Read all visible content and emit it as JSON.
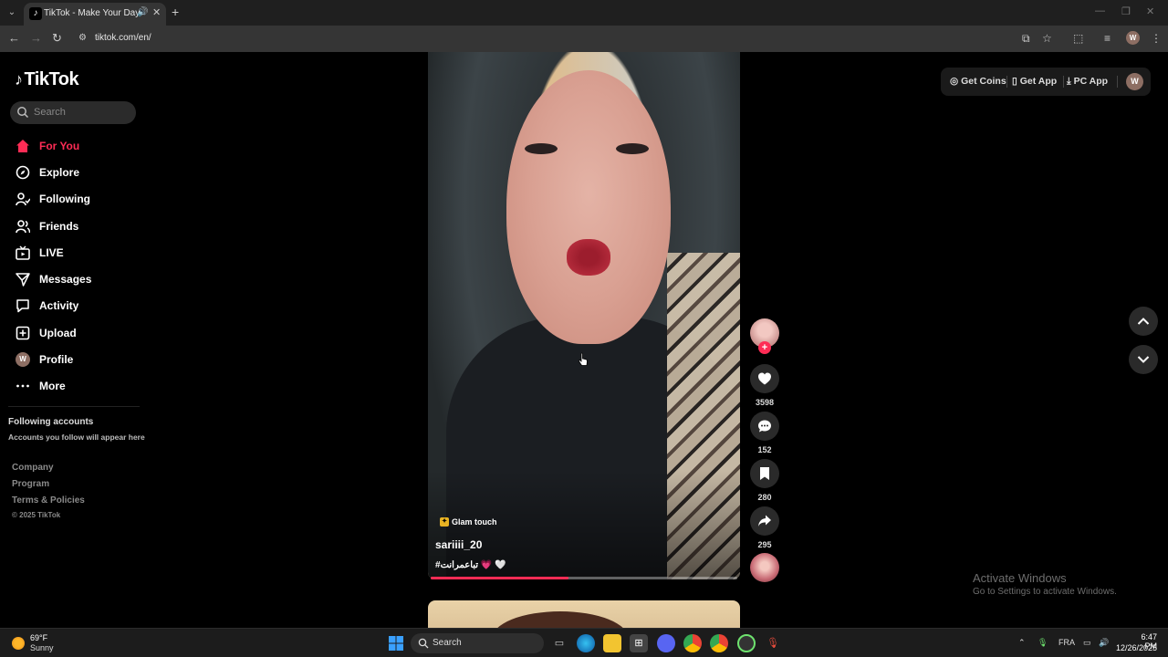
{
  "browser": {
    "tab_title": "TikTok - Make Your Day",
    "url": "tiktok.com/en/",
    "profile_initial": "W"
  },
  "tiktok": {
    "logo": "TikTok",
    "search_placeholder": "Search",
    "nav": [
      {
        "label": "For You",
        "icon": "home-icon",
        "active": true
      },
      {
        "label": "Explore",
        "icon": "compass-icon"
      },
      {
        "label": "Following",
        "icon": "following-icon"
      },
      {
        "label": "Friends",
        "icon": "friends-icon"
      },
      {
        "label": "LIVE",
        "icon": "live-icon"
      },
      {
        "label": "Messages",
        "icon": "messages-icon"
      },
      {
        "label": "Activity",
        "icon": "activity-icon"
      },
      {
        "label": "Upload",
        "icon": "upload-icon"
      },
      {
        "label": "Profile",
        "icon": "avatar"
      },
      {
        "label": "More",
        "icon": "more-icon"
      }
    ],
    "profile_initial": "W",
    "following_title": "Following accounts",
    "following_sub": "Accounts you follow will appear here",
    "footer": {
      "company": "Company",
      "program": "Program",
      "terms": "Terms & Policies",
      "copyright": "© 2025 TikTok"
    },
    "top_actions": {
      "get_coins": "Get Coins",
      "get_app": "Get App",
      "pc_app": "PC App"
    },
    "video": {
      "effect": "Glam touch",
      "author": "sariiii_20",
      "caption": "#تباعمرانت 💗 🤍",
      "progress": 0.45,
      "likes": "3598",
      "comments": "152",
      "saves": "280",
      "shares": "295"
    }
  },
  "watermark": {
    "title": "Activate Windows",
    "sub": "Go to Settings to activate Windows."
  },
  "taskbar": {
    "temp": "69°F",
    "weather": "Sunny",
    "search": "Search",
    "lang": "FRA",
    "time": "6:47 PM",
    "date": "12/26/2025"
  }
}
